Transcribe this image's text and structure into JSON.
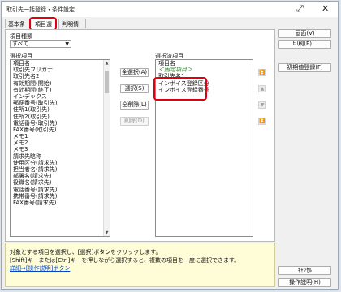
{
  "window": {
    "title": "取引先一括登録・条件設定",
    "expand_icon": "⤢",
    "close_icon": "✕"
  },
  "tabs": [
    {
      "label": "基本条件"
    },
    {
      "label": "項目選択"
    },
    {
      "label": "判明情報"
    }
  ],
  "field_type": {
    "label": "項目種類",
    "value": "すべて"
  },
  "available": {
    "label": "選択項目",
    "items": [
      "項目名",
      "取引先フリガナ",
      "取引先名2",
      "有効期間(開始)",
      "有効期間(終了)",
      "インデックス",
      "郵便番号(取引先)",
      "住所1(取引先)",
      "住所2(取引先)",
      "電話番号(取引先)",
      "FAX番号(取引先)",
      "メモ1",
      "メモ2",
      "メモ3",
      "請求先略称",
      "使用区分(請求先)",
      "担当者名(請求先)",
      "部署名(請求先)",
      "役職名(請求先)",
      "電話番号(請求先)",
      "携帯番号(請求先)",
      "FAX番号(請求先)"
    ]
  },
  "buttons_mid": {
    "select_all": "全選択(A)",
    "select": "選択(S)",
    "remove_all": "全削除(L)",
    "remove": "削除(D)"
  },
  "selected": {
    "label": "選択済項目",
    "items": [
      "項目名",
      "＜固定項目＞",
      "取引先名1",
      "インボイス登録区分",
      "インボイス登録番号"
    ]
  },
  "order_buttons": [
    "⏫",
    "▲",
    "▼",
    "⏬"
  ],
  "side_buttons": {
    "view": "画面(V)",
    "print": "印刷(P)...",
    "initial_register": "初期値登録(F)",
    "cancel": "ｷｬﾝｾﾙ",
    "help": "操作説明(H)"
  },
  "help_text": {
    "line1": "対象とする項目を選択し、[選択]ボタンをクリックします。",
    "line2": "[Shift]キーまたは[Ctrl]キーを押しながら選択すると、複数の項目を一度に選択できます。",
    "link": "詳細⇒[操作説明]ボタン"
  }
}
